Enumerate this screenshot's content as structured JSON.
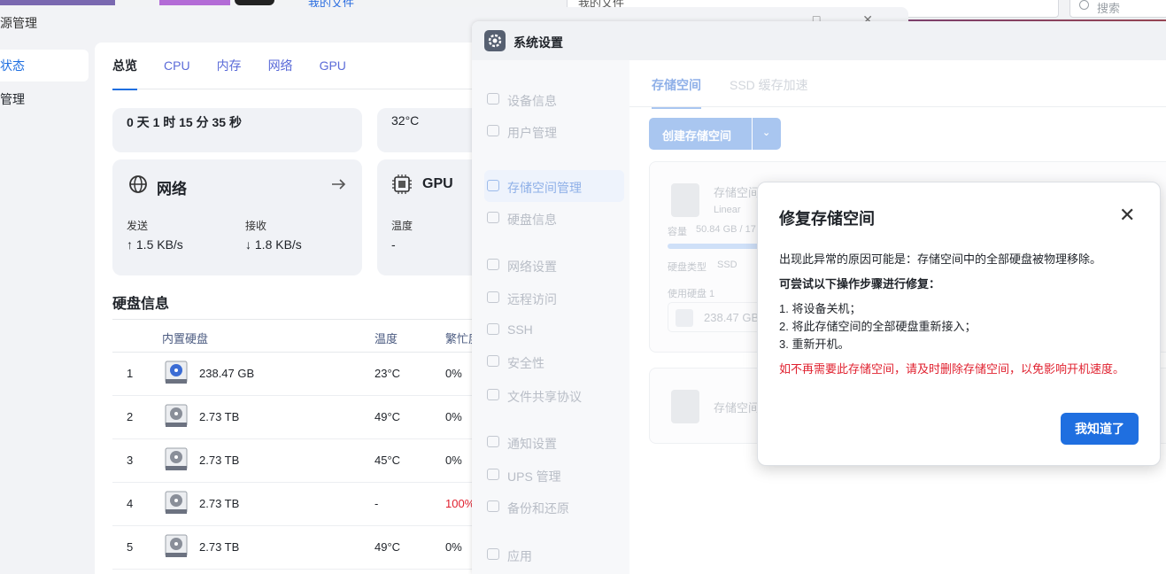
{
  "topbar": {
    "link": "我的文件",
    "path": "我的文件",
    "search_placeholder": "搜索"
  },
  "monitor": {
    "title": "源管理",
    "sidebar": [
      "状态",
      "管理"
    ],
    "tabs": [
      "总览",
      "CPU",
      "内存",
      "网络",
      "GPU"
    ],
    "uptime": "0 天 1 时 15 分 35 秒",
    "cpu_temp": "32°C",
    "network": {
      "title": "网络",
      "send_label": "发送",
      "send_value": "↑ 1.5 KB/s",
      "recv_label": "接收",
      "recv_value": "↓ 1.8 KB/s"
    },
    "gpu": {
      "title": "GPU",
      "temp_label": "温度",
      "temp_value": "-"
    },
    "disk_section": "硬盘信息",
    "disk_headers": [
      "内置硬盘",
      "温度",
      "繁忙度"
    ],
    "disks": [
      {
        "index": "1",
        "size": "238.47 GB",
        "temp": "23°C",
        "busy": "0%"
      },
      {
        "index": "2",
        "size": "2.73 TB",
        "temp": "49°C",
        "busy": "0%"
      },
      {
        "index": "3",
        "size": "2.73 TB",
        "temp": "45°C",
        "busy": "0%"
      },
      {
        "index": "4",
        "size": "2.73 TB",
        "temp": "-",
        "busy": "100%"
      },
      {
        "index": "5",
        "size": "2.73 TB",
        "temp": "49°C",
        "busy": "0%"
      }
    ]
  },
  "settings": {
    "title": "系统设置",
    "nav": [
      "设备信息",
      "用户管理",
      "存储空间管理",
      "硬盘信息",
      "网络设置",
      "远程访问",
      "SSH",
      "安全性",
      "文件共享协议",
      "通知设置",
      "UPS 管理",
      "备份和还原",
      "应用"
    ],
    "tabs": [
      "存储空间",
      "SSD 缓存加速"
    ],
    "create_button": "创建存储空间",
    "pool1": {
      "name": "存储空间",
      "type": "Linear",
      "capacity_label": "容量",
      "capacity": "50.84 GB / 17",
      "disk_type_label": "硬盘类型",
      "disk_type": "SSD",
      "used_disk_label": "使用硬盘 1",
      "used_disk": "238.47 GB"
    },
    "pool2": {
      "name": "存储空间"
    }
  },
  "dialog": {
    "title": "修复存储空间",
    "reason": "出现此异常的原因可能是：存储空间中的全部硬盘被物理移除。",
    "steps_title": "可尝试以下操作步骤进行修复：",
    "steps": [
      "1. 将设备关机；",
      "2. 将此存储空间的全部硬盘重新接入；",
      "3. 重新开机。"
    ],
    "warning": "如不再需要此存储空间，请及时删除存储空间，以免影响开机速度。",
    "ok_button": "我知道了"
  }
}
